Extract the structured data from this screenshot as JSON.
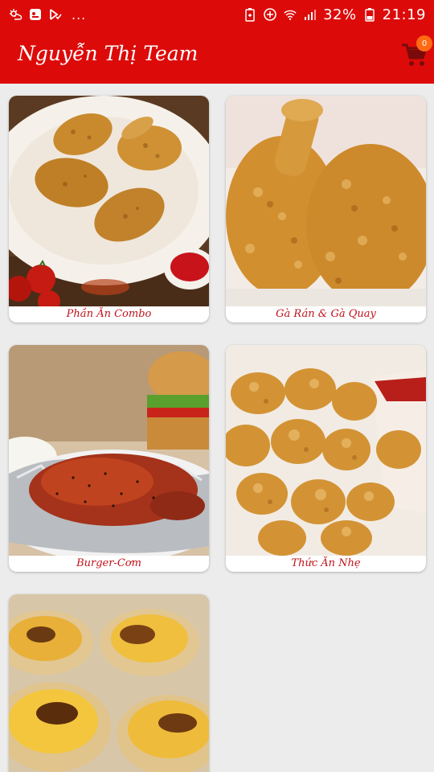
{
  "status_bar": {
    "battery_percent": "32%",
    "time": "21:19",
    "overflow": "..."
  },
  "app_bar": {
    "title": "Nguyễn Thị Team",
    "cart_count": "0"
  },
  "categories": [
    {
      "label": "Phần Ăn Combo",
      "image": "fried-chicken-plate"
    },
    {
      "label": "Gà Rán & Gà Quay",
      "image": "crispy-chicken"
    },
    {
      "label": "Burger-Cơm",
      "image": "burger-roast-chicken"
    },
    {
      "label": "Thức Ăn Nhẹ",
      "image": "popcorn-chicken"
    },
    {
      "label": "",
      "image": "egg-tarts"
    }
  ],
  "colors": {
    "primary": "#dd0a0a",
    "caption": "#c0121a",
    "badge": "#ff6a13",
    "background": "#ececec"
  }
}
